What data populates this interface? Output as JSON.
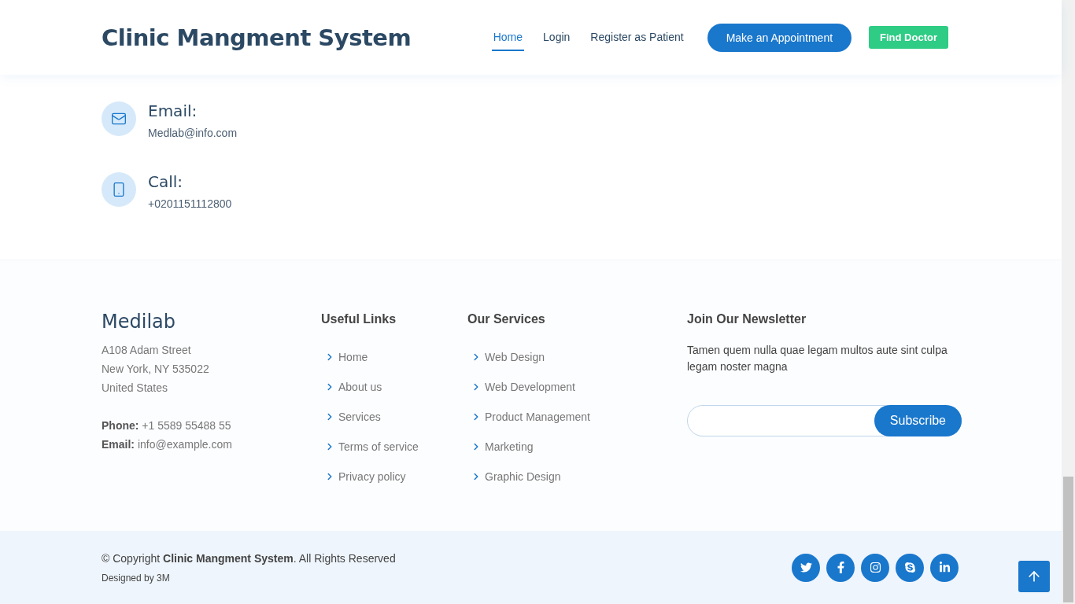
{
  "header": {
    "brand": "Clinic Mangment System",
    "nav": [
      {
        "label": "Home",
        "selected": true
      },
      {
        "label": "Login",
        "selected": false
      },
      {
        "label": "Register as Patient",
        "selected": false
      }
    ],
    "buttons": [
      {
        "label": "Make an Appointment",
        "kind": "pill"
      },
      {
        "label": "Find Doctor",
        "kind": "green"
      }
    ]
  },
  "contact": [
    {
      "kind": "email",
      "title": "Email:",
      "value": "Medlab@info.com"
    },
    {
      "kind": "phone",
      "title": "Call:",
      "value": "+0201151112800"
    }
  ],
  "footer": {
    "about": {
      "name": "Medilab",
      "address": [
        "A108 Adam Street",
        "New York, NY 535022",
        "United States"
      ],
      "details": [
        {
          "label": "Phone:",
          "value": "+1 5589 55488 55"
        },
        {
          "label": "Email:",
          "value": "info@example.com"
        }
      ]
    },
    "columns": [
      {
        "title": "Useful Links",
        "links": [
          "Home",
          "About us",
          "Services",
          "Terms of service",
          "Privacy policy"
        ]
      },
      {
        "title": "Our Services",
        "links": [
          "Web Design",
          "Web Development",
          "Product Management",
          "Marketing",
          "Graphic Design"
        ]
      }
    ],
    "newsletter": {
      "title": "Join Our Newsletter",
      "text": "Tamen quem nulla quae legam multos aute sint culpa legam noster magna",
      "button": "Subscribe"
    }
  },
  "bottom": {
    "copyright": "© Copyright **Clinic Mangment System**. All Rights Reserved",
    "credit": "Designed by 3M",
    "social": [
      {
        "kind": "twitter"
      },
      {
        "kind": "facebook"
      },
      {
        "kind": "instagram"
      },
      {
        "kind": "skype"
      },
      {
        "kind": "linkedin"
      }
    ]
  }
}
